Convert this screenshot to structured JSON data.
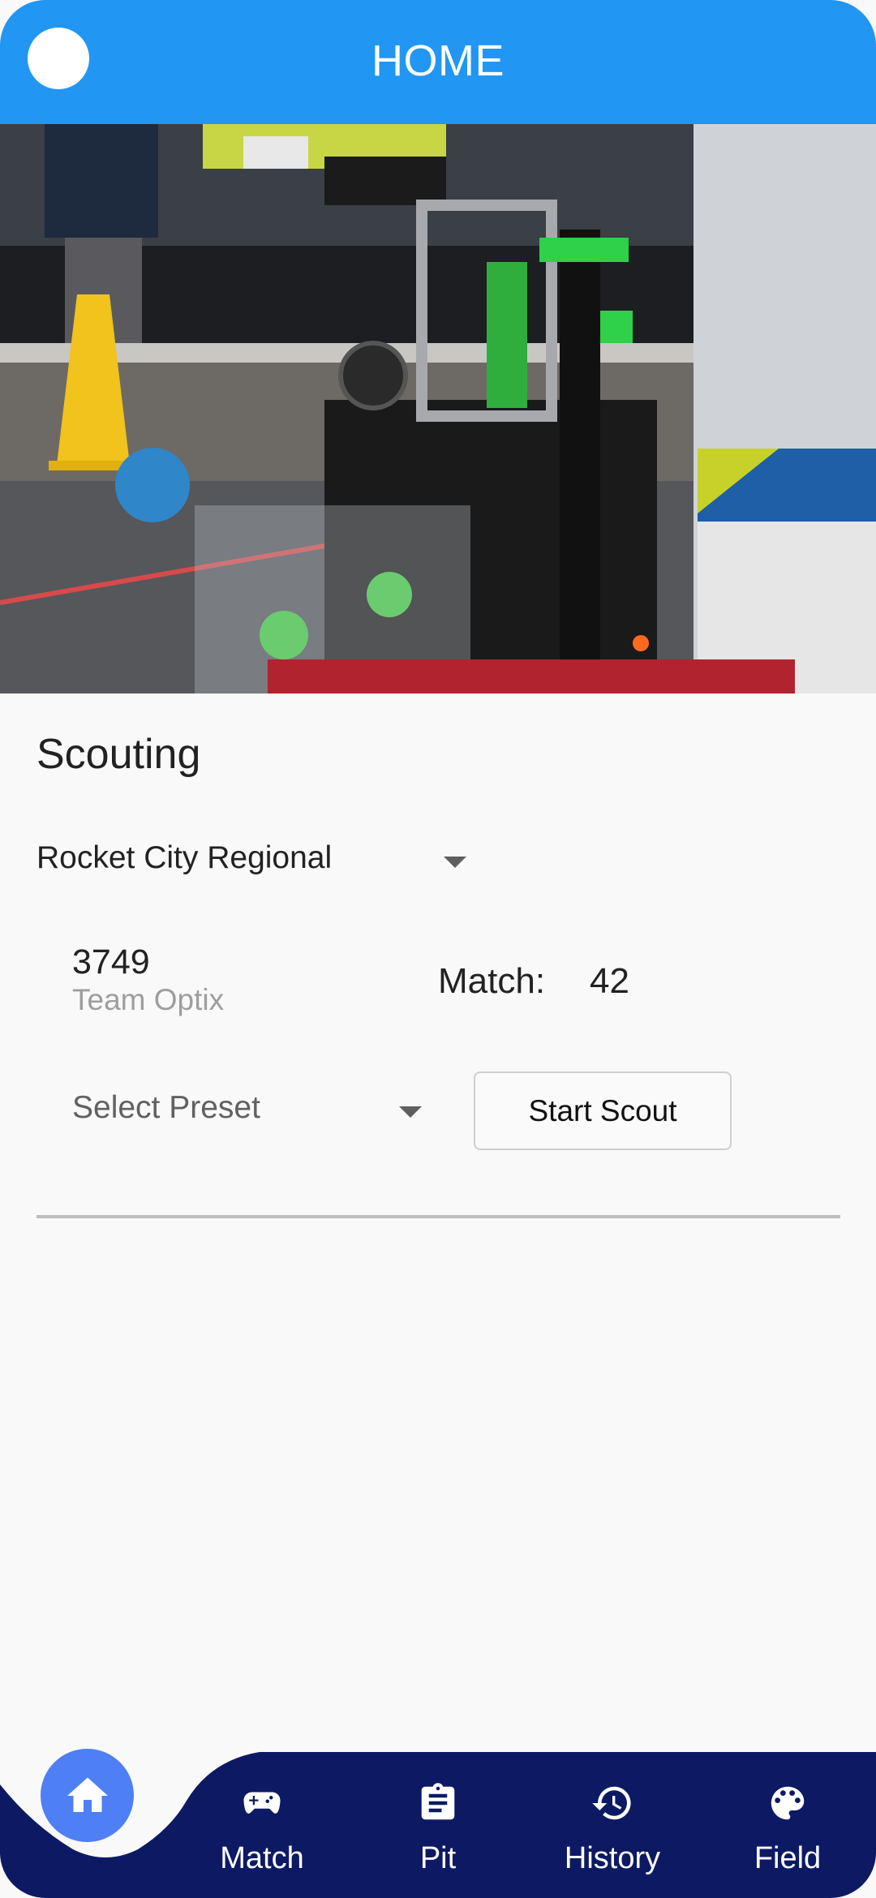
{
  "appbar": {
    "title": "HOME"
  },
  "hero": {
    "alt": "Robot at competition"
  },
  "scouting": {
    "title": "Scouting",
    "event": "Rocket City Regional",
    "team_number": "3749",
    "team_name": "Team Optix",
    "match_label": "Match:",
    "match_value": "42",
    "preset_placeholder": "Select Preset",
    "start_button": "Start Scout"
  },
  "nav": {
    "items": [
      {
        "label": "Match",
        "icon": "gamepad-icon"
      },
      {
        "label": "Pit",
        "icon": "clipboard-icon"
      },
      {
        "label": "History",
        "icon": "history-icon"
      },
      {
        "label": "Field",
        "icon": "palette-icon"
      }
    ],
    "active": "home-icon"
  },
  "colors": {
    "appbar": "#2196f3",
    "nav": "#0d1a63",
    "fab": "#4f7ff5",
    "background": "#f9f9f9"
  }
}
